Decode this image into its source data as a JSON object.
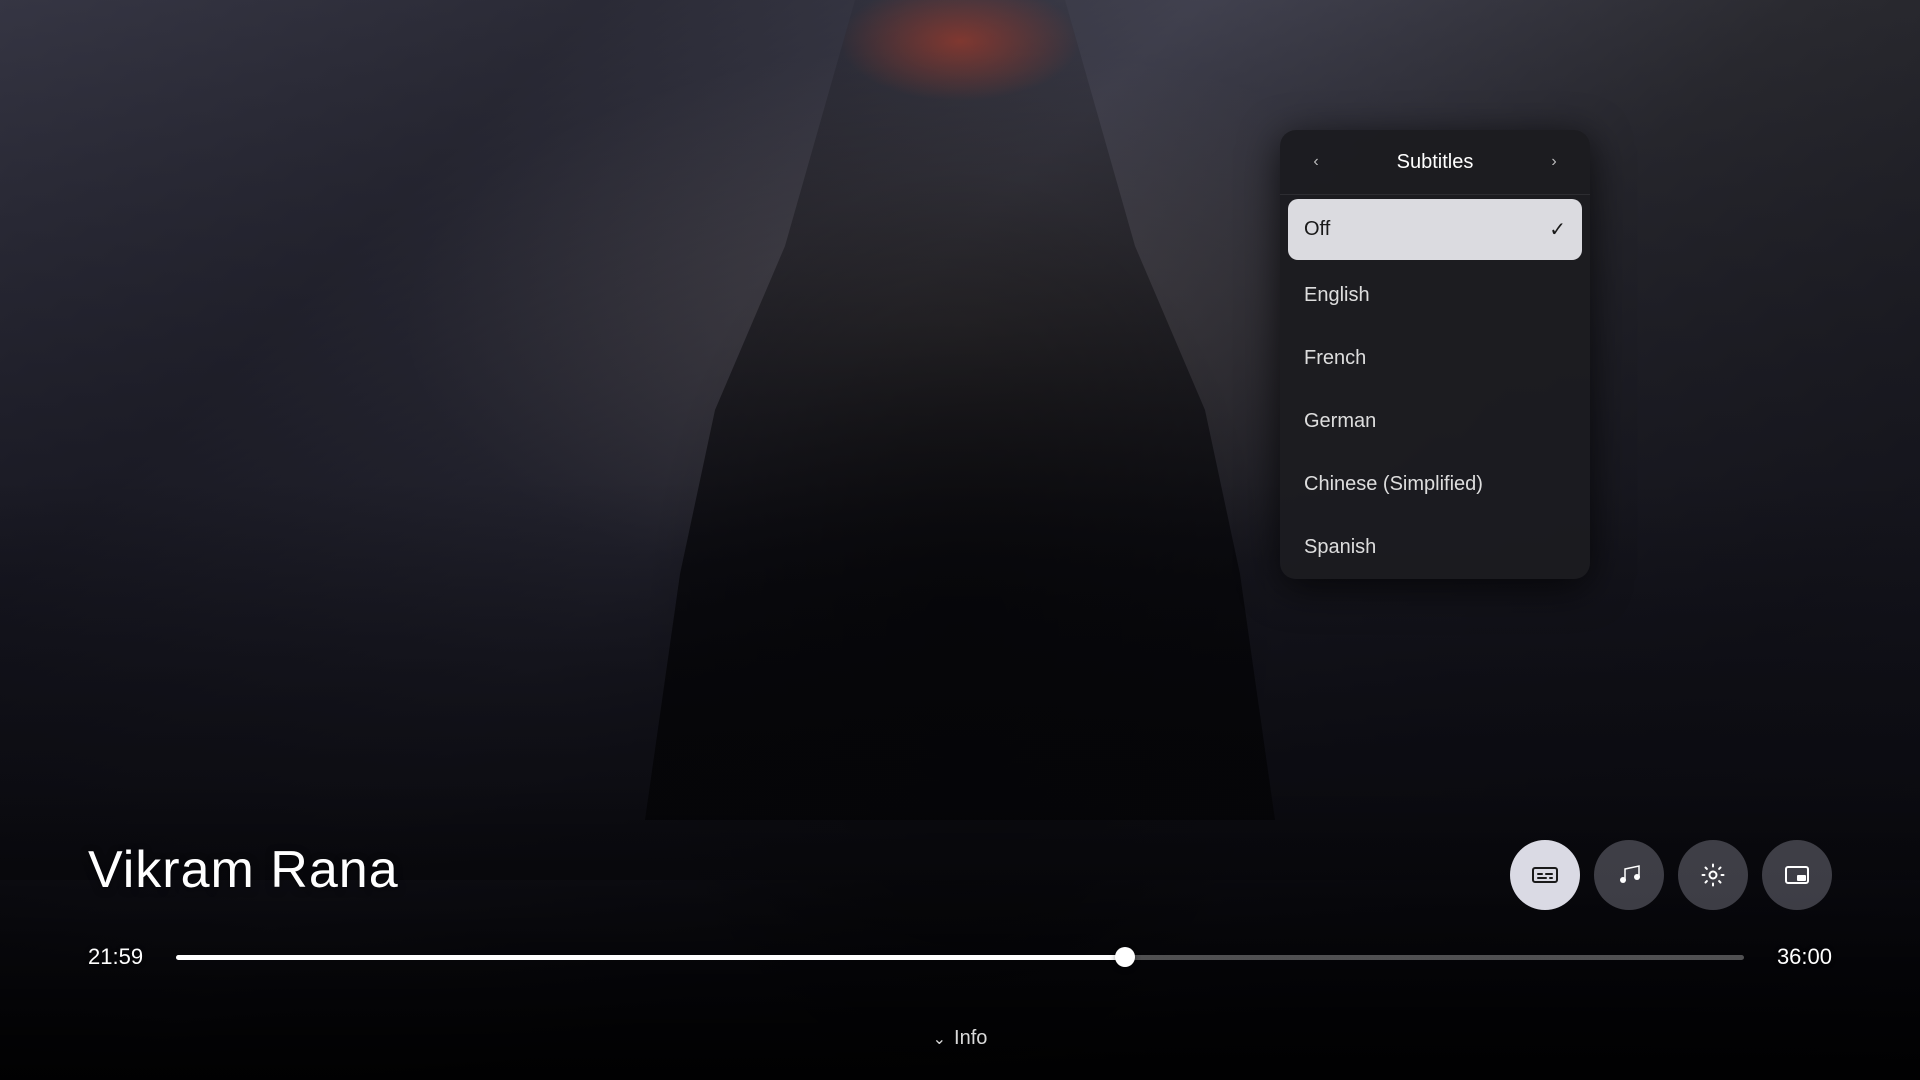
{
  "background": {
    "color_start": "#2a2a35",
    "color_end": "#0a0a0a"
  },
  "subtitle_menu": {
    "title": "Subtitles",
    "left_arrow": "‹",
    "right_arrow": "›",
    "items": [
      {
        "id": "off",
        "label": "Off",
        "selected": true
      },
      {
        "id": "english",
        "label": "English",
        "selected": false
      },
      {
        "id": "french",
        "label": "French",
        "selected": false
      },
      {
        "id": "german",
        "label": "German",
        "selected": false
      },
      {
        "id": "chinese-simplified",
        "label": "Chinese (Simplified)",
        "selected": false
      },
      {
        "id": "spanish",
        "label": "Spanish",
        "selected": false
      }
    ]
  },
  "player": {
    "movie_title": "Vikram Rana",
    "time_current": "21:59",
    "time_total": "36:00",
    "progress_percent": 60.5
  },
  "controls": [
    {
      "id": "subtitles",
      "icon": "cc",
      "active": true,
      "label": "Subtitles"
    },
    {
      "id": "audio",
      "icon": "music",
      "active": false,
      "label": "Audio"
    },
    {
      "id": "settings",
      "icon": "settings",
      "active": false,
      "label": "Settings"
    },
    {
      "id": "pip",
      "icon": "pip",
      "active": false,
      "label": "Picture in Picture"
    }
  ],
  "info_bar": {
    "chevron": "⌄",
    "label": "Info"
  }
}
